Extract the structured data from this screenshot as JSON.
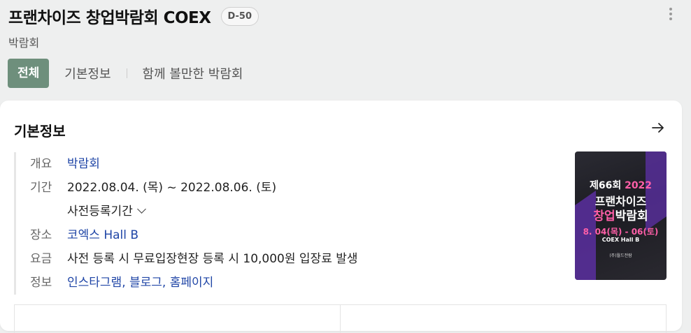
{
  "header": {
    "title": "프랜차이즈 창업박람회 COEX",
    "dday": "D-50",
    "category": "박람회"
  },
  "tabs": [
    {
      "label": "전체",
      "active": true
    },
    {
      "label": "기본정보",
      "active": false
    },
    {
      "label": "함께 볼만한 박람회",
      "active": false
    }
  ],
  "info": {
    "section_title": "기본정보",
    "overview_key": "개요",
    "overview_val": "박람회",
    "period_key": "기간",
    "period_val": "2022.08.04. (목) ~  2022.08.06. (토)",
    "prereg": "사전등록기간",
    "place_key": "장소",
    "place_val": "코엑스 Hall B",
    "fee_key": "요금",
    "fee_val": "사전 등록 시 무료입장현장 등록 시 10,000원 입장료 발생",
    "more_key": "정보",
    "more_val": "인스타그램, 블로그, 홈페이지"
  },
  "poster": {
    "line1_a": "제66회 ",
    "line1_b": "2022",
    "line2": "프랜차이즈",
    "line3_a": "창업",
    "line3_b": "박람회",
    "line4": "8. 04(목) - 06(토)",
    "line5": "COEX Hall B",
    "line6": "(주)월드전람"
  },
  "colors": {
    "accent": "#6e8f7c",
    "link": "#1f45a6",
    "poster_pink": "#ff5fa8",
    "poster_purple": "#5a2fa0"
  },
  "icons": {
    "more": "more-vertical-icon",
    "arrow": "arrow-right-icon",
    "chevron": "chevron-down-icon"
  }
}
